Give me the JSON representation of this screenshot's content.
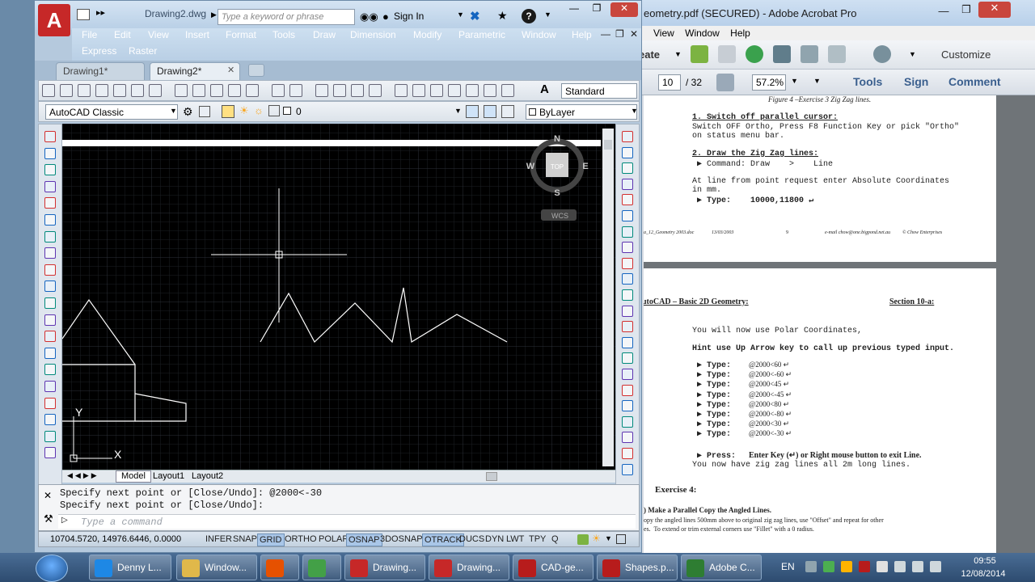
{
  "acad": {
    "doc_title": "Drawing2.dwg",
    "search_placeholder": "Type a keyword or phrase",
    "sign_in": "Sign In",
    "menu": [
      "File",
      "Edit",
      "View",
      "Insert",
      "Format",
      "Tools",
      "Draw",
      "Dimension",
      "Modify",
      "Parametric",
      "Window",
      "Help"
    ],
    "menu2": [
      "Express",
      "Raster"
    ],
    "tabs": [
      "Drawing1*",
      "Drawing2*"
    ],
    "text_style": "Standard",
    "workspace": "AutoCAD Classic",
    "layer": "0",
    "linetype": "ByLayer",
    "viewcube": {
      "north": "N",
      "south": "S",
      "east": "E",
      "west": "W",
      "top": "TOP",
      "wcs": "WCS"
    },
    "ucs": {
      "y": "Y",
      "x": "X"
    },
    "sheet_tabs": [
      "Model",
      "Layout1",
      "Layout2"
    ],
    "command_history": [
      "Specify next point or [Close/Undo]: @2000<-30",
      "Specify next point or [Close/Undo]:"
    ],
    "command_placeholder": "Type a command",
    "coordinates": "10704.5720, 14976.6446, 0.0000",
    "status_toggles": [
      {
        "label": "INFER",
        "on": false
      },
      {
        "label": "SNAP",
        "on": false
      },
      {
        "label": "GRID",
        "on": true
      },
      {
        "label": "ORTHO",
        "on": false
      },
      {
        "label": "POLAR",
        "on": false
      },
      {
        "label": "OSNAP",
        "on": true
      },
      {
        "label": "3DOSNAP",
        "on": false
      },
      {
        "label": "OTRACK",
        "on": true
      },
      {
        "label": "DUCS",
        "on": false
      },
      {
        "label": "DYN",
        "on": false
      },
      {
        "label": "LWT",
        "on": false
      },
      {
        "label": "TPY",
        "on": false
      },
      {
        "label": "Q",
        "on": false
      }
    ]
  },
  "acrobat": {
    "title": "eometry.pdf (SECURED) - Adobe Acrobat Pro",
    "menu": [
      "View",
      "Window",
      "Help"
    ],
    "create_label": "eate",
    "customize_label": "Customize",
    "page_current": "10",
    "page_total": "/ 32",
    "zoom": "57.2%",
    "tools_label": "Tools",
    "sign_label": "Sign",
    "comment_label": "Comment",
    "page1": {
      "caption": "Figure 4 –Exercise 3 Zig Zag lines.",
      "step1_title": "1. Switch off parallel cursor:",
      "step1_text_a": "Switch OFF Ortho, Press F8 Function Key or pick \"Ortho\"",
      "step1_text_b": "on status menu bar.",
      "step2_title": "2. Draw the Zig Zag lines:",
      "step2_cmd": "▶ Command: Draw    >    Line",
      "step2_text_a": "At line from point request enter Absolute Coordinates",
      "step2_text_b": "in mm.",
      "step2_type": "▶ Type:    10000,11800 ↵",
      "footer_file": "a_12_Geometry 2003.doc",
      "footer_date": "13/03/2003",
      "footer_page": "9",
      "footer_email": "e-mail chow@one.bigpond.net.au",
      "footer_brand": "© Chow Enterprises"
    },
    "page2": {
      "header_left": "utoCAD – Basic 2D Geometry:",
      "header_right": "Section 10-a:",
      "intro": "You will now use Polar Coordinates,",
      "hint": "Hint use Up Arrow key to call up previous typed input.",
      "types": [
        "@2000<60 ↵",
        "@2000<-60 ↵",
        "@2000<45 ↵",
        "@2000<-45 ↵",
        "@2000<80 ↵",
        "@2000<-80 ↵",
        "@2000<30 ↵",
        "@2000<-30 ↵"
      ],
      "type_label": "▶ Type:",
      "press_label": "▶ Press:",
      "press_text": "Enter Key (↵) or Right mouse button to exit Line.",
      "result": "You now have zig zag lines all 2m long lines.",
      "exercise": "Exercise 4:",
      "ex_item": ") Make a Parallel Copy the Angled Lines.",
      "ex_text_a": "opy the angled lines 500mm above to original zig zag lines, use \"Offset\" and repeat for other",
      "ex_text_b": "es.  To extend or trim external corners use \"Fillet\" with a 0 radius."
    }
  },
  "taskbar": {
    "items": [
      {
        "name": "ie",
        "label": "Denny L...",
        "color": "#1e88e5"
      },
      {
        "name": "explorer",
        "label": "Window...",
        "color": "#e0b84a"
      },
      {
        "name": "media",
        "label": "",
        "color": "#e65100"
      },
      {
        "name": "chrome",
        "label": "",
        "color": "#43a047"
      },
      {
        "name": "acad1",
        "label": "Drawing...",
        "color": "#c62828"
      },
      {
        "name": "acad2",
        "label": "Drawing...",
        "color": "#c62828"
      },
      {
        "name": "pdf1",
        "label": "CAD-ge...",
        "color": "#b71c1c"
      },
      {
        "name": "pdf2",
        "label": "Shapes.p...",
        "color": "#b71c1c"
      },
      {
        "name": "captivate",
        "label": "Adobe C...",
        "color": "#2e7d32"
      }
    ],
    "lang": "EN",
    "time": "09:55",
    "date": "12/08/2014"
  }
}
